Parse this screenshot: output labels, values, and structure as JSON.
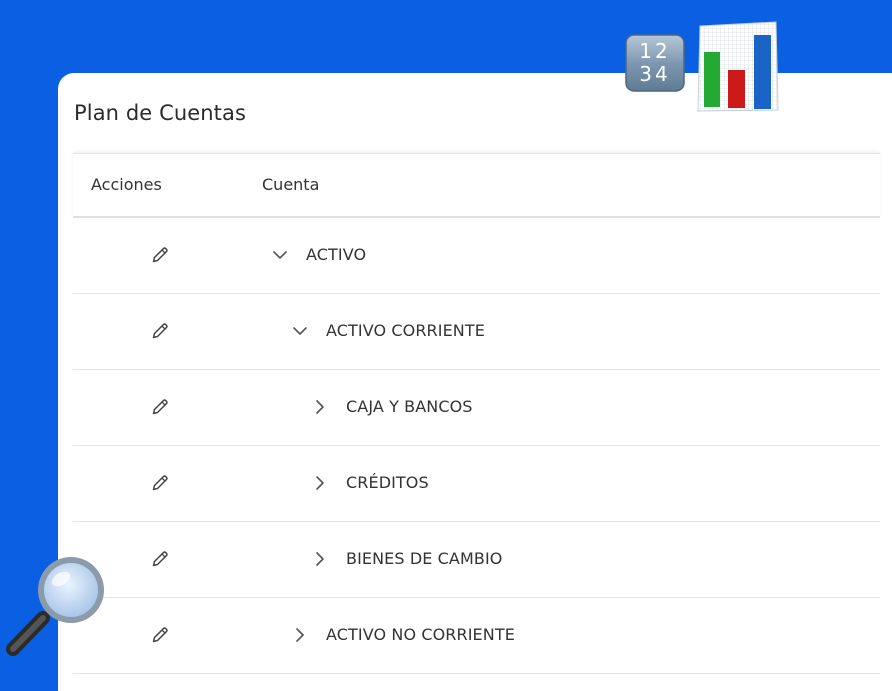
{
  "card": {
    "title": "Plan de Cuentas"
  },
  "table": {
    "headers": {
      "actions": "Acciones",
      "account": "Cuenta"
    },
    "rows": [
      {
        "label": "ACTIVO",
        "level": 0,
        "expanded": true
      },
      {
        "label": "ACTIVO CORRIENTE",
        "level": 1,
        "expanded": true
      },
      {
        "label": "CAJA Y BANCOS",
        "level": 2,
        "expanded": false
      },
      {
        "label": "CRÉDITOS",
        "level": 2,
        "expanded": false
      },
      {
        "label": "BIENES DE CAMBIO",
        "level": 2,
        "expanded": false
      },
      {
        "label": "ACTIVO NO CORRIENTE",
        "level": 1,
        "expanded": false
      }
    ]
  },
  "icons": {
    "edit": "pencil-icon",
    "expanded": "chevron-down-icon",
    "collapsed": "chevron-right-icon",
    "numbers": "numbers-1234-icon",
    "chart": "bar-chart-icon",
    "search": "magnifier-icon"
  },
  "colors": {
    "background": "#0a5fe3",
    "card": "#ffffff",
    "text": "#333333"
  }
}
